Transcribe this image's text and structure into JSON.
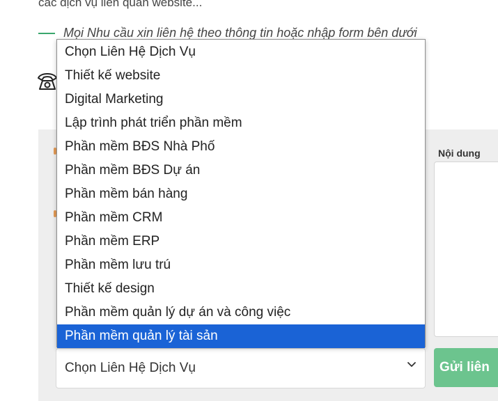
{
  "intro": {
    "text": "các dịch vụ liên quan website...",
    "note": "Mọi Nhu cầu xin liên hệ theo thông tin hoặc nhập form bên dưới"
  },
  "form": {
    "content_label": "Nội dung",
    "submit_label": "Gửi liên",
    "select": {
      "selected_value": "Chọn Liên Hệ Dịch Vụ",
      "highlighted_index": 12,
      "options": [
        "Chọn Liên Hệ Dịch Vụ",
        "Thiết kế website",
        "Digital Marketing",
        "Lập trình phát triển phần mềm",
        "Phần mềm BĐS Nhà Phố",
        "Phần mềm BĐS Dự án",
        "Phần mềm bán hàng",
        "Phần mềm CRM",
        "Phần mềm ERP",
        "Phần mềm lưu trú",
        "Thiết kế design",
        "Phần mềm quản lý dự án và công việc",
        "Phần mềm quản lý tài sản"
      ]
    }
  },
  "icons": {
    "phone": "phone-icon",
    "chevron": "chevron-down-icon"
  },
  "colors": {
    "accent_green": "#3aa76d",
    "submit_bg": "#6cc48e",
    "highlight": "#1a63d6",
    "panel_bg": "#eeeeee"
  }
}
